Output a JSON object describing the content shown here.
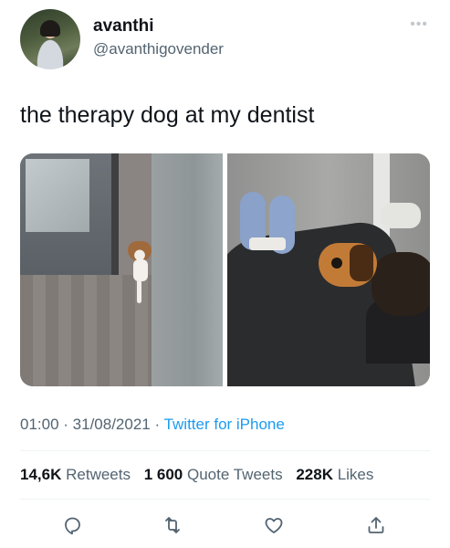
{
  "author": {
    "name": "avanthi",
    "handle": "@avanthigovender"
  },
  "more_label": "•••",
  "tweet": {
    "text": "the therapy dog at my dentist"
  },
  "meta": {
    "time": "01:00",
    "separator1": " · ",
    "date": "31/08/2021",
    "separator2": " · ",
    "source": "Twitter for iPhone"
  },
  "stats": {
    "retweets_count": "14,6K",
    "retweets_label": "Retweets",
    "quotes_count": "1 600",
    "quotes_label": "Quote Tweets",
    "likes_count": "228K",
    "likes_label": "Likes"
  },
  "icons": {
    "reply": "reply-icon",
    "retweet": "retweet-icon",
    "like": "like-icon",
    "share": "share-icon"
  },
  "colors": {
    "accent": "#1d9bf0",
    "secondary_text": "#536471",
    "primary_text": "#0f1419",
    "divider": "#eff3f4"
  }
}
